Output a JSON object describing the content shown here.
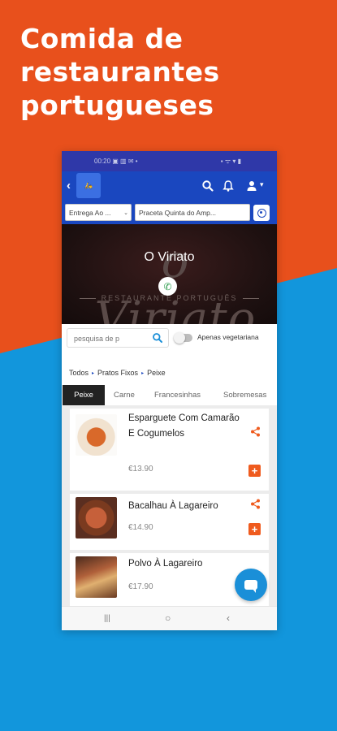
{
  "headline": {
    "line1": "Comida de",
    "line2": "restaurantes",
    "line3": "portugueses"
  },
  "statusbar": {
    "time": "00:20",
    "icons_left": "▣ ▥ ✉ •",
    "icons_right": "▪ ᯤ ▾ ▮"
  },
  "appbar": {
    "back": "‹",
    "logo_text": "🛵",
    "account_arrow": "▾"
  },
  "filters": {
    "delivery": "Entrega Ao ...",
    "address": "Praceta Quinta do Amp...",
    "arrow": "⌄"
  },
  "hero": {
    "background_script": "o Viriato",
    "background_sub": "RESTAURANTE PORTUGUÊS",
    "title": "O Viriato",
    "call_icon": "✆"
  },
  "search": {
    "placeholder": "pesquisa de p"
  },
  "vegetarian_label": "Apenas vegetariana",
  "breadcrumb": {
    "all": "Todos",
    "fixed": "Pratos Fixos",
    "current": "Peixe",
    "sep": "▸"
  },
  "tabs": [
    "Peixe",
    "Carne",
    "Francesinhas",
    "Sobremesas"
  ],
  "products": [
    {
      "name": "Esparguete Com Camarão E Cogumelos",
      "price": "€13.90"
    },
    {
      "name": "Bacalhau À Lagareiro",
      "price": "€14.90"
    },
    {
      "name": "Polvo À Lagareiro",
      "price": "€17.90"
    }
  ],
  "add_label": "+",
  "navbar": {
    "recents": "|||",
    "home": "○",
    "back": "‹"
  },
  "colors": {
    "orange": "#e8501c",
    "blue": "#1296dc",
    "appbar": "#1a47bf",
    "accent": "#ef5b1e"
  }
}
